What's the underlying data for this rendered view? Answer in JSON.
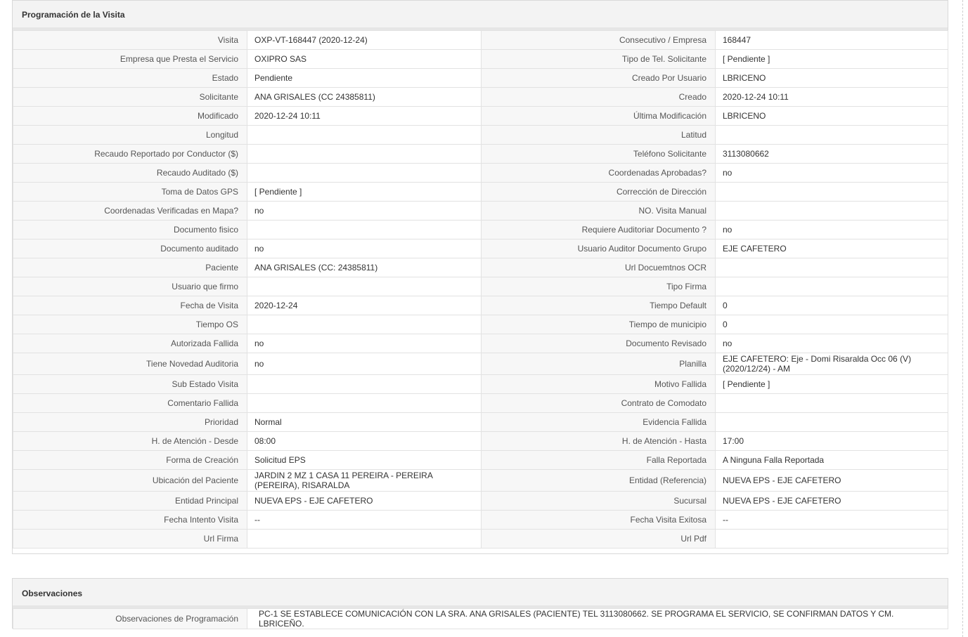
{
  "section_prog": {
    "title": "Programación de la Visita"
  },
  "rows": [
    {
      "l1": "Visita",
      "v1": "OXP-VT-168447 (2020-12-24)",
      "l2": "Consecutivo / Empresa",
      "v2": "168447"
    },
    {
      "l1": "Empresa que Presta el Servicio",
      "v1": "OXIPRO SAS",
      "l2": "Tipo de Tel. Solicitante",
      "v2": "[ Pendiente ]"
    },
    {
      "l1": "Estado",
      "v1": "Pendiente",
      "l2": "Creado Por Usuario",
      "v2": "LBRICENO"
    },
    {
      "l1": "Solicitante",
      "v1": "ANA GRISALES (CC 24385811)",
      "l2": "Creado",
      "v2": "2020-12-24 10:11"
    },
    {
      "l1": "Modificado",
      "v1": "2020-12-24 10:11",
      "l2": "Última Modificación",
      "v2": " LBRICENO"
    },
    {
      "l1": "Longitud",
      "v1": "",
      "l2": "Latitud",
      "v2": ""
    },
    {
      "l1": "Recaudo Reportado por Conductor ($)",
      "v1": "",
      "l2": "Teléfono Solicitante",
      "v2": "3113080662"
    },
    {
      "l1": "Recaudo Auditado ($)",
      "v1": "",
      "l2": "Coordenadas Aprobadas?",
      "v2": " no"
    },
    {
      "l1": "Toma de Datos GPS",
      "v1": "[ Pendiente ]",
      "l2": "Corrección de Dirección",
      "v2": ""
    },
    {
      "l1": "Coordenadas Verificadas en Mapa?",
      "v1": " no",
      "l2": "NO. Visita Manual",
      "v2": ""
    },
    {
      "l1": "Documento fisico",
      "v1": "",
      "l2": "Requiere Auditoriar Documento ?",
      "v2": " no"
    },
    {
      "l1": "Documento auditado",
      "v1": " no",
      "l2": "Usuario Auditor Documento Grupo",
      "v2": "EJE CAFETERO"
    },
    {
      "l1": "Paciente",
      "v1": "ANA GRISALES (CC: 24385811)",
      "l2": "Url Docuemtnos OCR",
      "v2": ""
    },
    {
      "l1": "Usuario que firmo",
      "v1": "",
      "l2": "Tipo Firma",
      "v2": ""
    },
    {
      "l1": "Fecha de Visita",
      "v1": " 2020-12-24",
      "l2": "Tiempo Default",
      "v2": "0"
    },
    {
      "l1": "Tiempo OS",
      "v1": "",
      "l2": "Tiempo de municipio",
      "v2": "0"
    },
    {
      "l1": "Autorizada Fallida",
      "v1": " no",
      "l2": "Documento Revisado",
      "v2": " no"
    },
    {
      "l1": "Tiene Novedad Auditoria",
      "v1": " no",
      "l2": "Planilla",
      "v2": "EJE CAFETERO: Eje - Domi Risaralda Occ 06 (V) (2020/12/24) - AM",
      "tall": true
    },
    {
      "l1": "Sub Estado Visita",
      "v1": "",
      "l2": "Motivo Fallida",
      "v2": "[ Pendiente ]"
    },
    {
      "l1": "Comentario Fallida",
      "v1": "",
      "l2": "Contrato de Comodato",
      "v2": ""
    },
    {
      "l1": "Prioridad",
      "v1": "Normal",
      "l2": "Evidencia Fallida",
      "v2": ""
    },
    {
      "l1": "H. de Atención - Desde",
      "v1": "08:00",
      "l2": "H. de Atención - Hasta",
      "v2": "17:00"
    },
    {
      "l1": "Forma de Creación",
      "v1": "Solicitud EPS",
      "l2": "Falla Reportada",
      "v2": "A Ninguna Falla Reportada"
    },
    {
      "l1": "Ubicación del Paciente",
      "v1": "JARDIN 2 MZ 1 CASA 11 PEREIRA - PEREIRA (PEREIRA), RISARALDA",
      "l2": "Entidad (Referencia)",
      "v2": "NUEVA EPS - EJE CAFETERO",
      "tall": true
    },
    {
      "l1": "Entidad Principal",
      "v1": "NUEVA EPS - EJE CAFETERO",
      "l2": "Sucursal",
      "v2": "NUEVA EPS - EJE CAFETERO"
    },
    {
      "l1": "Fecha Intento Visita",
      "v1": " --",
      "l2": "Fecha Visita Exitosa",
      "v2": " --"
    },
    {
      "l1": "Url Firma",
      "v1": "",
      "l2": "Url Pdf",
      "v2": ""
    }
  ],
  "section_obs": {
    "title": "Observaciones",
    "label": "Observaciones de Programación",
    "value": "PC-1 SE ESTABLECE COMUNICACIÓN CON LA SRA. ANA GRISALES (PACIENTE) TEL 3113080662. SE PROGRAMA EL SERVICIO, SE CONFIRMAN DATOS Y CM. LBRICEÑO."
  }
}
